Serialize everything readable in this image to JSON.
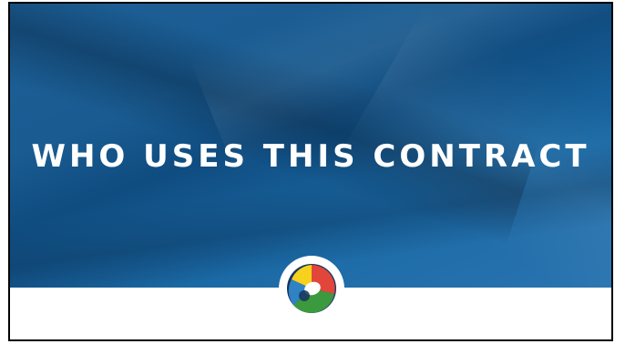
{
  "slide": {
    "title": "WHO USES THIS CONTRACT",
    "logo_icon": "circular-color-segments-logo"
  },
  "colors": {
    "hero_blue": "#1a5c92",
    "logo_red": "#e2463b",
    "logo_yellow": "#f6d21c",
    "logo_green": "#3c9a3e",
    "logo_blue": "#2f82c4",
    "logo_navy": "#17345e"
  }
}
